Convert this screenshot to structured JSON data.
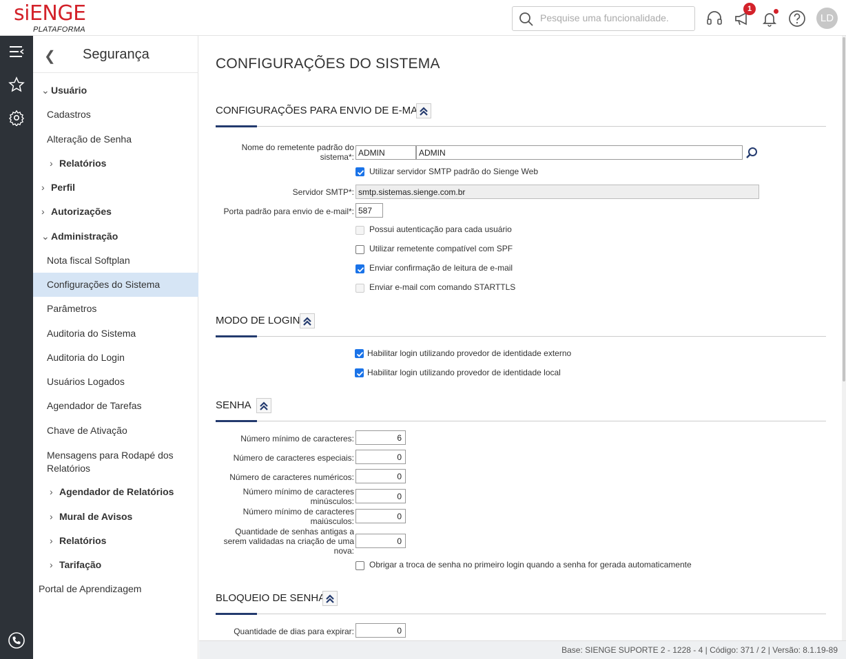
{
  "header": {
    "logo": "siENGE",
    "logo_sub": "PLATAFORMA",
    "search_placeholder": "Pesquise uma funcionalidade.",
    "notification_badge": "1",
    "avatar_initials": "LD"
  },
  "rail": {
    "icons": [
      "menu-icon",
      "star-icon",
      "gear-icon",
      "phone-icon"
    ]
  },
  "sidebar": {
    "title": "Segurança",
    "items": [
      {
        "label": "Usuário",
        "bold": true,
        "chevron": "down"
      },
      {
        "label": "Cadastros"
      },
      {
        "label": "Alteração de Senha"
      },
      {
        "label": "Relatórios",
        "bold": true,
        "chevron": "right"
      },
      {
        "label": "Perfil",
        "bold": true,
        "chevron": "right"
      },
      {
        "label": "Autorizações",
        "bold": true,
        "chevron": "right"
      },
      {
        "label": "Administração",
        "bold": true,
        "chevron": "down"
      },
      {
        "label": "Nota fiscal Softplan"
      },
      {
        "label": "Configurações do Sistema",
        "selected": true
      },
      {
        "label": "Parâmetros"
      },
      {
        "label": "Auditoria do Sistema"
      },
      {
        "label": "Auditoria do Login"
      },
      {
        "label": "Usuários Logados"
      },
      {
        "label": "Agendador de Tarefas"
      },
      {
        "label": "Chave de Ativação"
      },
      {
        "label": "Mensagens para Rodapé dos Relatórios"
      },
      {
        "label": "Agendador de Relatórios",
        "bold": true,
        "chevron": "right"
      },
      {
        "label": "Mural de Avisos",
        "bold": true,
        "chevron": "right"
      },
      {
        "label": "Relatórios",
        "bold": true,
        "chevron": "right"
      },
      {
        "label": "Tarifação",
        "bold": true,
        "chevron": "right"
      },
      {
        "label": "Portal de Aprendizagem"
      }
    ]
  },
  "main": {
    "page_title": "CONFIGURAÇÕES DO SISTEMA",
    "email": {
      "title": "CONFIGURAÇÕES PARA ENVIO DE E-MAIL",
      "sender_label": "Nome do remetente padrão do sistema*:",
      "sender_code": "ADMIN",
      "sender_name": "ADMIN",
      "use_default_smtp": "Utilizar servidor SMTP padrão do Sienge Web",
      "smtp_label": "Servidor SMTP*:",
      "smtp_value": "smtp.sistemas.sienge.com.br",
      "port_label": "Porta padrão para envio de e-mail*:",
      "port_value": "587",
      "auth_per_user": "Possui autenticação para cada usuário",
      "spf_sender": "Utilizar remetente compatível com SPF",
      "read_confirmation": "Enviar confirmação de leitura de e-mail",
      "starttls": "Enviar e-mail com comando STARTTLS"
    },
    "login": {
      "title": "MODO DE LOGIN",
      "external_idp": "Habilitar login utilizando provedor de identidade externo",
      "local_idp": "Habilitar login utilizando provedor de identidade local"
    },
    "password": {
      "title": "SENHA",
      "min_chars_label": "Número mínimo de caracteres:",
      "min_chars": "6",
      "special_label": "Número de caracteres especiais:",
      "special": "0",
      "numeric_label": "Número de caracteres numéricos:",
      "numeric": "0",
      "lower_label_1": "Número mínimo de caracteres",
      "lower_label_2": "minúsculos:",
      "lower": "0",
      "upper_label_1": "Número mínimo de caracteres",
      "upper_label_2": "maiúsculos:",
      "upper": "0",
      "old_label_1": "Quantidade de senhas antigas a",
      "old_label_2": "serem validadas na criação de uma",
      "old_label_3": "nova:",
      "old": "0",
      "force_change": "Obrigar a troca de senha no primeiro login quando a senha for gerada automaticamente"
    },
    "lock": {
      "title": "BLOQUEIO DE SENHA",
      "expire_label": "Quantidade de dias para expirar:",
      "expire": "0"
    }
  },
  "footer": {
    "text": "Base: SIENGE SUPORTE 2 - 1228 - 4 | Código: 371 / 2 | Versão: 8.1.19-89"
  },
  "colors": {
    "brand": "#d3222a",
    "accent": "#233a6e",
    "selected": "#d6e5f5",
    "rail": "#2d3238",
    "checkbox": "#1a73e8"
  }
}
